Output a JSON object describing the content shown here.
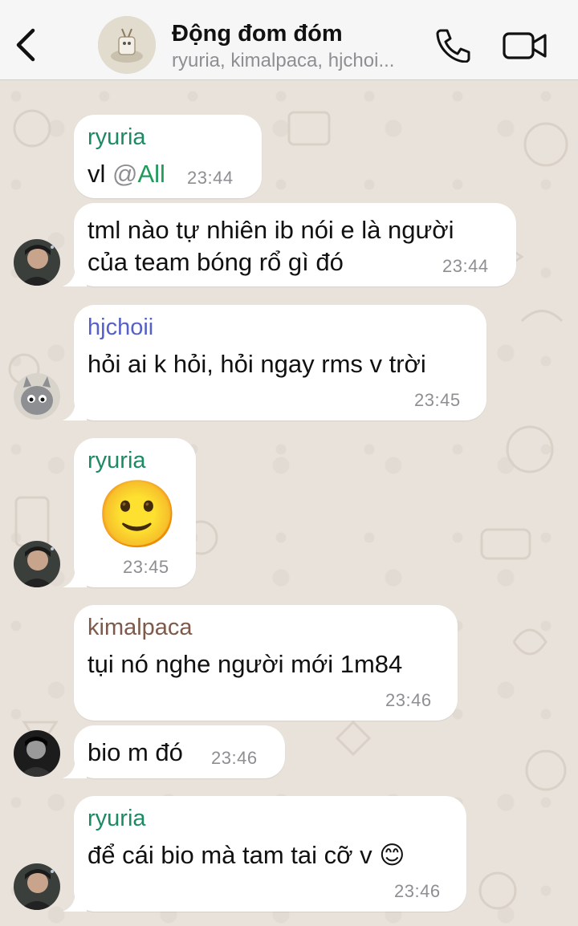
{
  "header": {
    "title": "Động đom đóm",
    "subtitle": "ryuria, kimalpaca, hjchoi..."
  },
  "colors": {
    "ryuria": "#1c8a63",
    "hjchoii": "#5561c8",
    "kimalpaca": "#7d5a4b",
    "mention": "#1f9a5a"
  },
  "messages": [
    {
      "sender": "ryuria",
      "text": "vl ",
      "mention_at": "@",
      "mention_name": "All",
      "time": "23:44"
    },
    {
      "line1": "tml nào tự nhiên ib nói e là người",
      "line2": "của team bóng rổ gì đó",
      "time": "23:44"
    },
    {
      "sender": "hjchoii",
      "text": "hỏi ai k hỏi, hỏi ngay rms v trời",
      "time": "23:45"
    },
    {
      "sender": "ryuria",
      "emoji": "🙂",
      "time": "23:45"
    },
    {
      "sender": "kimalpaca",
      "text": "tụi nó nghe người mới 1m84",
      "time": "23:46"
    },
    {
      "text": "bio m đó",
      "time": "23:46"
    },
    {
      "sender": "ryuria",
      "text": "để cái bio mà tam tai cỡ v",
      "emoji": "😊",
      "time": "23:46"
    }
  ]
}
